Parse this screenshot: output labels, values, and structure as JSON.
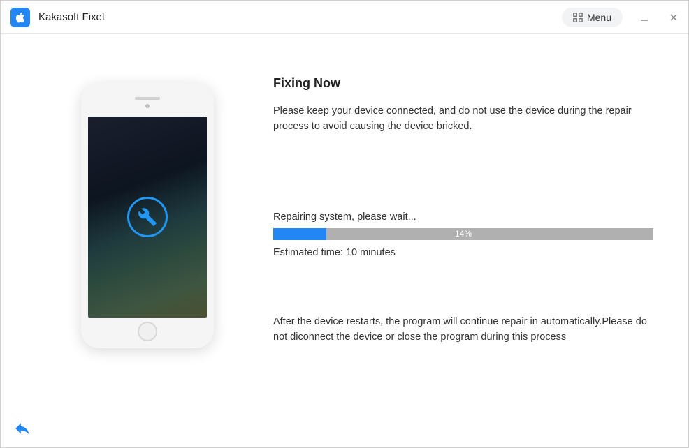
{
  "app": {
    "title": "Kakasoft Fixet",
    "menu_label": "Menu"
  },
  "main": {
    "heading": "Fixing Now",
    "description": "Please keep your device connected, and do not use the device during the repair process to avoid causing the device bricked.",
    "status_label": "Repairing system, please wait...",
    "progress_percent": 14,
    "progress_text": "14%",
    "estimated_time": "Estimated time: 10 minutes",
    "footnote": "After the device restarts, the program will continue repair in automatically.Please do not diconnect the device or close the program during this process"
  },
  "icons": {
    "app_logo": "apple-logo-icon",
    "menu": "grid-menu-icon",
    "minimize": "minimize-icon",
    "close": "close-icon",
    "wrench": "wrench-icon",
    "back": "back-arrow-icon"
  },
  "colors": {
    "accent": "#2386f5",
    "progress_bg": "#b0b0b0"
  }
}
